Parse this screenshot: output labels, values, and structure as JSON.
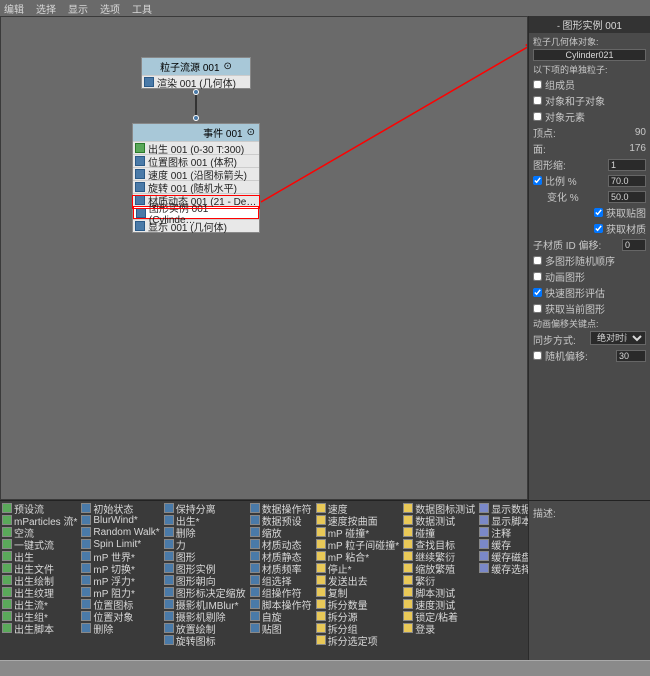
{
  "menu": {
    "items": [
      "编辑",
      "选择",
      "显示",
      "选项",
      "工具"
    ]
  },
  "flow_node": {
    "title": "粒子流源 001",
    "row": "渲染 001 (几何体)"
  },
  "event_node": {
    "title": "事件 001",
    "rows": [
      "出生 001 (0-30 T:300)",
      "位置图标 001 (体积)",
      "速度 001 (沿图标箭头)",
      "旋转 001 (随机水平)",
      "材质动态 001 (21 - De…",
      "图形实例 001 (Cylinde…",
      "显示 001 (几何体)"
    ],
    "sel_index": 5
  },
  "panel": {
    "header": "图形实例 001",
    "obj_label": "粒子几何体对象:",
    "obj_value": "Cylinder021",
    "sep_label": "以下项的单独粒子:",
    "chk_group": "组成员",
    "chk_children": "对象和子对象",
    "chk_elements": "对象元素",
    "vert_label": "顶点:",
    "vert_val": "90",
    "face_label": "面:",
    "face_val": "176",
    "shape_label": "图形缩:",
    "shape_val": "1",
    "scale_label": "比例 %",
    "scale_val": "70.0",
    "var_label": "变化 %",
    "var_val": "50.0",
    "chk_map": "获取贴图",
    "chk_mat": "获取材质",
    "submat_label": "子材质 ID 偏移:",
    "submat_val": "0",
    "chk_multi": "多图形随机顺序",
    "chk_anim": "动画图形",
    "chk_fast": "快速图形评估",
    "chk_cur": "获取当前图形",
    "anim_label": "动画偏移关键点:",
    "sync_label": "同步方式:",
    "sync_val": "绝对时间",
    "rand_label": "随机偏移:",
    "rand_val": "30"
  },
  "toolbox": {
    "cols": [
      [
        {
          "c": "c1",
          "t": "预设流"
        },
        {
          "c": "c1",
          "t": "mParticles 流*"
        },
        {
          "c": "c1",
          "t": "空流"
        },
        {
          "c": "c1",
          "t": "一键式流"
        },
        {
          "c": "c1",
          "t": "出生"
        },
        {
          "c": "c1",
          "t": "出生文件"
        },
        {
          "c": "c1",
          "t": "出生绘制"
        },
        {
          "c": "c1",
          "t": "出生纹理"
        },
        {
          "c": "c1",
          "t": "出生流*"
        },
        {
          "c": "c1",
          "t": "出生组*"
        },
        {
          "c": "c1",
          "t": "出生脚本"
        }
      ],
      [
        {
          "c": "c2",
          "t": "初始状态"
        },
        {
          "c": "c2",
          "t": "BlurWind*"
        },
        {
          "c": "c2",
          "t": "Random Walk*"
        },
        {
          "c": "c2",
          "t": "Spin Limit*"
        },
        {
          "c": "c2",
          "t": "mP 世界*"
        },
        {
          "c": "c2",
          "t": "mP 切换*"
        },
        {
          "c": "c2",
          "t": "mP 浮力*"
        },
        {
          "c": "c2",
          "t": "mP 阻力*"
        },
        {
          "c": "c2",
          "t": "位置图标"
        },
        {
          "c": "c2",
          "t": "位置对象"
        },
        {
          "c": "c2",
          "t": "删除"
        }
      ],
      [
        {
          "c": "c2",
          "t": "保持分离"
        },
        {
          "c": "c2",
          "t": "出生*"
        },
        {
          "c": "c2",
          "t": "删除"
        },
        {
          "c": "c2",
          "t": "力"
        },
        {
          "c": "c2",
          "t": "图形"
        },
        {
          "c": "c2",
          "t": "图形实例"
        },
        {
          "c": "c2",
          "t": "图形朝向"
        },
        {
          "c": "c2",
          "t": "图形标决定缩放"
        },
        {
          "c": "c2",
          "t": "摄影机IMBlur*"
        },
        {
          "c": "c2",
          "t": "摄影机剔除"
        },
        {
          "c": "c2",
          "t": "放置绘制"
        },
        {
          "c": "c2",
          "t": "旋转图标"
        }
      ],
      [
        {
          "c": "c2",
          "t": "数据操作符"
        },
        {
          "c": "c2",
          "t": "数据预设"
        },
        {
          "c": "c2",
          "t": "缩放"
        },
        {
          "c": "c2",
          "t": "材质动态"
        },
        {
          "c": "c2",
          "t": "材质静态"
        },
        {
          "c": "c2",
          "t": "材质频率"
        },
        {
          "c": "c2",
          "t": "组选择"
        },
        {
          "c": "c2",
          "t": "组操作符"
        },
        {
          "c": "c2",
          "t": "脚本操作符"
        },
        {
          "c": "c2",
          "t": "自旋"
        },
        {
          "c": "c2",
          "t": "贴图"
        }
      ],
      [
        {
          "c": "c3",
          "t": "速度"
        },
        {
          "c": "c3",
          "t": "速度按曲面"
        },
        {
          "c": "c3",
          "t": "mP 碰撞*"
        },
        {
          "c": "c3",
          "t": "mP 粒子间碰撞*"
        },
        {
          "c": "c3",
          "t": "mP 粘合*"
        },
        {
          "c": "c3",
          "t": "停止*"
        },
        {
          "c": "c3",
          "t": "发送出去"
        },
        {
          "c": "c3",
          "t": "复制"
        },
        {
          "c": "c3",
          "t": "拆分数量"
        },
        {
          "c": "c3",
          "t": "拆分源"
        },
        {
          "c": "c3",
          "t": "拆分组"
        },
        {
          "c": "c3",
          "t": "拆分选定项"
        }
      ],
      [
        {
          "c": "c3",
          "t": "数据图标测试"
        },
        {
          "c": "c3",
          "t": "数据测试"
        },
        {
          "c": "c3",
          "t": "碰撞"
        },
        {
          "c": "c3",
          "t": "查找目标"
        },
        {
          "c": "c3",
          "t": "继续繁衍"
        },
        {
          "c": "c3",
          "t": "缩放繁殖"
        },
        {
          "c": "c3",
          "t": "繁衍"
        },
        {
          "c": "c3",
          "t": "脚本测试"
        },
        {
          "c": "c3",
          "t": "速度测试"
        },
        {
          "c": "c3",
          "t": "锁定/粘着"
        },
        {
          "c": "c3",
          "t": "登录"
        }
      ],
      [
        {
          "c": "c4",
          "t": "显示数据"
        },
        {
          "c": "c4",
          "t": "显示脚本*"
        },
        {
          "c": "c4",
          "t": "注释"
        },
        {
          "c": "c4",
          "t": "缓存"
        },
        {
          "c": "c4",
          "t": "缓存磁盘"
        },
        {
          "c": "c4",
          "t": "缓存选择性"
        }
      ]
    ]
  },
  "desc": {
    "label": "描述:"
  }
}
